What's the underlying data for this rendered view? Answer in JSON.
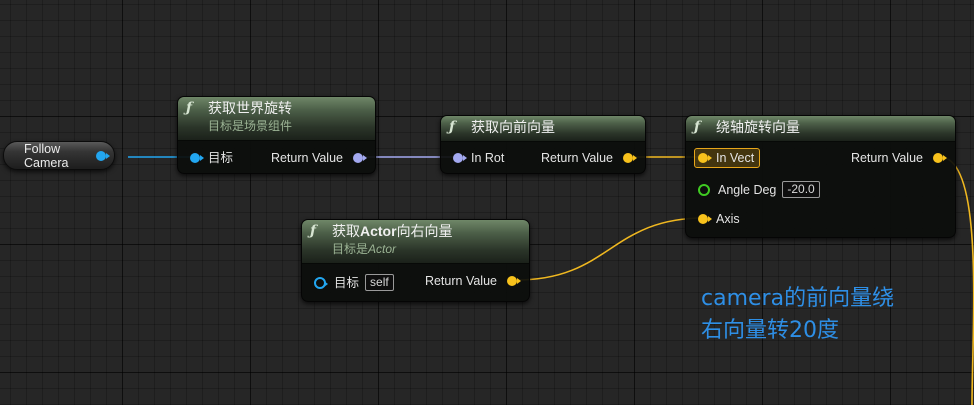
{
  "variable_node": {
    "label": "Follow Camera"
  },
  "nodes": {
    "get_world_rotation": {
      "title": "获取世界旋转",
      "subtitle": "目标是场景组件",
      "input_label": "目标",
      "output_label": "Return Value"
    },
    "get_forward_vector": {
      "title": "获取向前向量",
      "input_label": "In Rot",
      "output_label": "Return Value"
    },
    "rotate_vector_around_axis": {
      "title": "绕轴旋转向量",
      "inputs": [
        {
          "label": "In Vect"
        },
        {
          "label": "Angle Deg",
          "value": "-20.0"
        },
        {
          "label": "Axis"
        }
      ],
      "output_label": "Return Value"
    },
    "get_actor_right_vector": {
      "title_prefix": "获取",
      "title_bold": "Actor",
      "title_suffix": "向右向量",
      "subtitle_prefix": "目标是",
      "subtitle_italic": "Actor",
      "input_label": "目标",
      "input_value": "self",
      "output_label": "Return Value"
    }
  },
  "comment": {
    "line1": "camera的前向量绕",
    "line2": "右向量转20度"
  },
  "colors": {
    "object_pin": "#22a6f0",
    "rotator_pin": "#a3a9f0",
    "vector_pin": "#f8c21c",
    "float_pin": "#3fca22",
    "comment_text": "#2e8fe6",
    "function_header": "#4c5f48"
  }
}
